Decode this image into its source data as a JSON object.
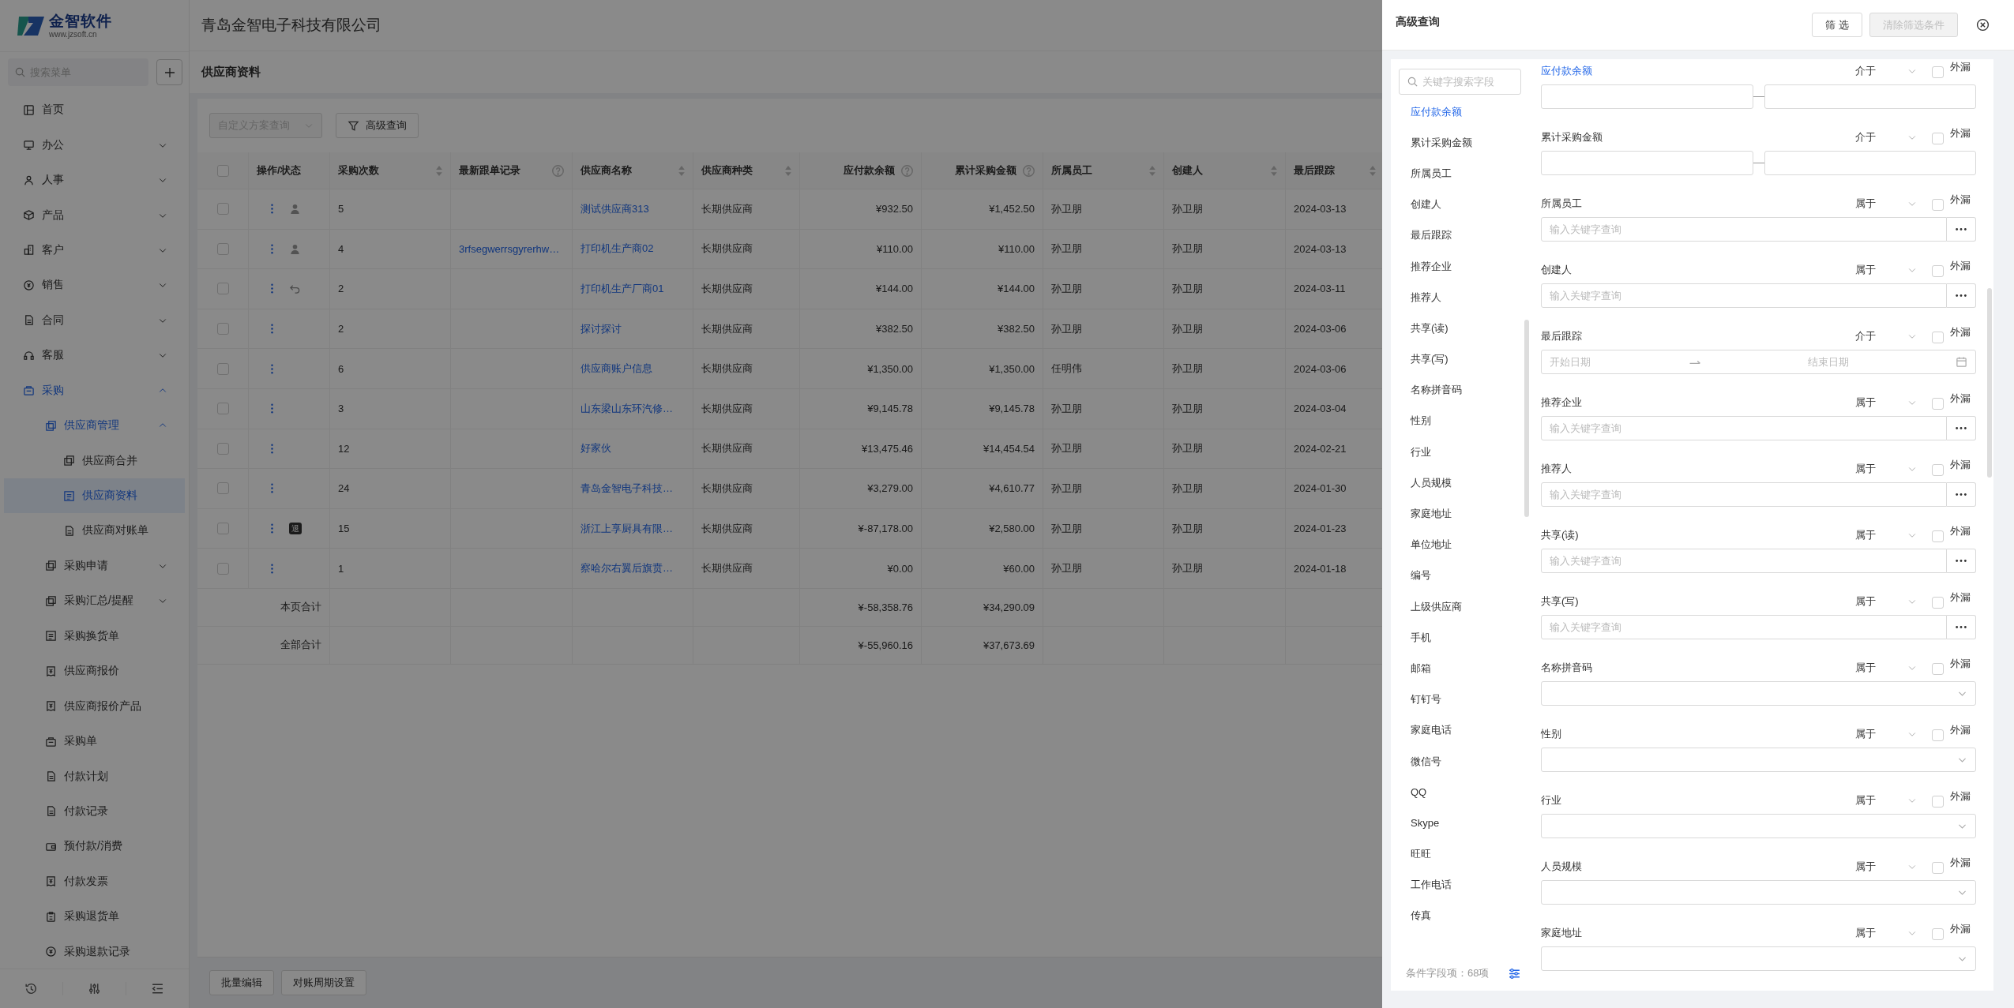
{
  "sidebar": {
    "brand": "金智软件",
    "url": "www.jzsoft.cn",
    "search": {
      "placeholder": "搜索菜单"
    },
    "items": [
      {
        "label": "首页",
        "selected": false
      },
      {
        "label": "办公",
        "selected": false,
        "expanded": false
      },
      {
        "label": "人事",
        "selected": false,
        "expanded": false
      },
      {
        "label": "产品",
        "selected": false,
        "expanded": false
      },
      {
        "label": "客户",
        "selected": false,
        "expanded": false
      },
      {
        "label": "销售",
        "selected": false,
        "expanded": false
      },
      {
        "label": "合同",
        "selected": false,
        "expanded": false
      },
      {
        "label": "客服",
        "selected": false,
        "expanded": false
      },
      {
        "label": "采购",
        "selected": false,
        "expanded": true,
        "children": [
          {
            "label": "供应商管理",
            "selected": false,
            "expanded": true,
            "children": [
              {
                "label": "供应商合并",
                "selected": false
              },
              {
                "label": "供应商资料",
                "selected": true
              },
              {
                "label": "供应商对账单",
                "selected": false
              }
            ]
          },
          {
            "label": "采购申请",
            "selected": false,
            "expanded": false
          },
          {
            "label": "采购汇总/提醒",
            "selected": false,
            "expanded": false
          },
          {
            "label": "采购换货单",
            "selected": false
          },
          {
            "label": "供应商报价",
            "selected": false
          },
          {
            "label": "供应商报价产品",
            "selected": false
          },
          {
            "label": "采购单",
            "selected": false
          },
          {
            "label": "付款计划",
            "selected": false
          },
          {
            "label": "付款记录",
            "selected": false
          },
          {
            "label": "预付款/消费",
            "selected": false
          },
          {
            "label": "付款发票",
            "selected": false
          },
          {
            "label": "采购退货单",
            "selected": false
          },
          {
            "label": "采购退款记录",
            "selected": false
          }
        ]
      }
    ]
  },
  "header": {
    "company": "青岛金智电子科技有限公司"
  },
  "page": {
    "title": "供应商资料",
    "scheme_select": {
      "placeholder": "自定义方案查询",
      "disabled": true
    },
    "advanced_button": "高级查询"
  },
  "table": {
    "select_all": {
      "checked": false
    },
    "columns": [
      {
        "label": "操作/状态",
        "kind": "actions"
      },
      {
        "label": "采购次数",
        "kind": "text",
        "sortable": true
      },
      {
        "label": "最新跟单记录",
        "kind": "link",
        "help": true
      },
      {
        "label": "供应商名称",
        "kind": "link",
        "sortable": true
      },
      {
        "label": "供应商种类",
        "kind": "text",
        "sortable": true
      },
      {
        "label": "应付款余额",
        "kind": "amount",
        "help": true
      },
      {
        "label": "累计采购金额",
        "kind": "amount",
        "help": true
      },
      {
        "label": "所属员工",
        "kind": "text",
        "sortable": true
      },
      {
        "label": "创建人",
        "kind": "text",
        "sortable": true
      },
      {
        "label": "最后跟踪",
        "kind": "text",
        "sortable": true
      }
    ],
    "rows": [
      {
        "checked": false,
        "status": {
          "kind": "person"
        },
        "count": "5",
        "name": "测试供应商313",
        "type": "长期供应商",
        "payable": "¥932.50",
        "total": "¥1,452.50",
        "employee": "孙卫朋",
        "creator": "孙卫朋",
        "last_follow": "2024-03-13"
      },
      {
        "checked": false,
        "status": {
          "kind": "person"
        },
        "count": "4",
        "latest_record": "3rfsegwerrsgyrerhw…",
        "name": "打印机生产商02",
        "type": "长期供应商",
        "payable": "¥110.00",
        "total": "¥110.00",
        "employee": "孙卫朋",
        "creator": "孙卫朋",
        "last_follow": "2024-03-13"
      },
      {
        "checked": false,
        "status": {
          "kind": "undo"
        },
        "count": "2",
        "name": "打印机生产厂商01",
        "type": "长期供应商",
        "payable": "¥144.00",
        "total": "¥144.00",
        "employee": "孙卫朋",
        "creator": "孙卫朋",
        "last_follow": "2024-03-11"
      },
      {
        "checked": false,
        "count": "2",
        "name": "探讨探讨",
        "type": "长期供应商",
        "payable": "¥382.50",
        "total": "¥382.50",
        "employee": "孙卫朋",
        "creator": "孙卫朋",
        "last_follow": "2024-03-06"
      },
      {
        "checked": false,
        "count": "6",
        "name": "供应商账户信息",
        "type": "长期供应商",
        "payable": "¥1,350.00",
        "total": "¥1,350.00",
        "employee": "任明伟",
        "creator": "孙卫朋",
        "last_follow": "2024-03-06"
      },
      {
        "checked": false,
        "count": "3",
        "name": "山东梁山东环汽修…",
        "type": "长期供应商",
        "payable": "¥9,145.78",
        "total": "¥9,145.78",
        "employee": "孙卫朋",
        "creator": "孙卫朋",
        "last_follow": "2024-03-04"
      },
      {
        "checked": false,
        "count": "12",
        "name": "好家伙",
        "type": "长期供应商",
        "payable": "¥13,475.46",
        "total": "¥14,454.54",
        "employee": "孙卫朋",
        "creator": "孙卫朋",
        "last_follow": "2024-02-21"
      },
      {
        "checked": false,
        "count": "24",
        "name": "青岛金智电子科技…",
        "type": "长期供应商",
        "payable": "¥3,279.00",
        "total": "¥4,610.77",
        "employee": "孙卫朋",
        "creator": "孙卫朋",
        "last_follow": "2024-01-30"
      },
      {
        "checked": false,
        "status": {
          "kind": "badge",
          "text": "退"
        },
        "count": "15",
        "name": "浙江上享厨具有限…",
        "type": "长期供应商",
        "payable": "¥-87,178.00",
        "total": "¥2,580.00",
        "employee": "孙卫朋",
        "creator": "孙卫朋",
        "last_follow": "2024-01-23"
      },
      {
        "checked": false,
        "count": "1",
        "name": "察哈尔右翼后旗贲…",
        "type": "长期供应商",
        "payable": "¥0.00",
        "total": "¥60.00",
        "employee": "孙卫朋",
        "creator": "孙卫朋",
        "last_follow": "2024-01-18"
      }
    ],
    "summaries": [
      {
        "label": "本页合计",
        "payable": "¥-58,358.76",
        "total": "¥34,290.09"
      },
      {
        "label": "全部合计",
        "payable": "¥-55,960.16",
        "total": "¥37,673.69"
      }
    ]
  },
  "footer_buttons": [
    "批量编辑",
    "对账周期设置"
  ],
  "drawer": {
    "title": "高级查询",
    "buttons": [
      {
        "label": "筛 选",
        "disabled": false
      },
      {
        "label": "清除筛选条件",
        "disabled": true
      }
    ],
    "field_search": {
      "placeholder": "关键字搜索字段"
    },
    "fields": [
      {
        "label": "应付款余额",
        "selected": true
      },
      {
        "label": "累计采购金额",
        "selected": false
      },
      {
        "label": "所属员工",
        "selected": false
      },
      {
        "label": "创建人",
        "selected": false
      },
      {
        "label": "最后跟踪",
        "selected": false
      },
      {
        "label": "推荐企业",
        "selected": false
      },
      {
        "label": "推荐人",
        "selected": false
      },
      {
        "label": "共享(读)",
        "selected": false
      },
      {
        "label": "共享(写)",
        "selected": false
      },
      {
        "label": "名称拼音码",
        "selected": false
      },
      {
        "label": "性别",
        "selected": false
      },
      {
        "label": "行业",
        "selected": false
      },
      {
        "label": "人员规模",
        "selected": false
      },
      {
        "label": "家庭地址",
        "selected": false
      },
      {
        "label": "单位地址",
        "selected": false
      },
      {
        "label": "编号",
        "selected": false
      },
      {
        "label": "上级供应商",
        "selected": false
      },
      {
        "label": "手机",
        "selected": false
      },
      {
        "label": "邮箱",
        "selected": false
      },
      {
        "label": "钉钉号",
        "selected": false
      },
      {
        "label": "家庭电话",
        "selected": false
      },
      {
        "label": "微信号",
        "selected": false
      },
      {
        "label": "QQ",
        "selected": false
      },
      {
        "label": "Skype",
        "selected": false
      },
      {
        "label": "旺旺",
        "selected": false
      },
      {
        "label": "工作电话",
        "selected": false
      },
      {
        "label": "传真",
        "selected": false
      }
    ],
    "field_count": "条件字段项：68项",
    "conditions": [
      {
        "label": "应付款余额",
        "highlighted": true,
        "operator": "介于",
        "kind": "range",
        "checked": false,
        "checkbox_label": "外漏"
      },
      {
        "label": "累计采购金额",
        "highlighted": false,
        "operator": "介于",
        "kind": "range",
        "checked": false,
        "checkbox_label": "外漏"
      },
      {
        "label": "所属员工",
        "highlighted": false,
        "operator": "属于",
        "kind": "picker",
        "placeholder": "输入关键字查询",
        "checked": false,
        "checkbox_label": "外漏"
      },
      {
        "label": "创建人",
        "highlighted": false,
        "operator": "属于",
        "kind": "picker",
        "placeholder": "输入关键字查询",
        "checked": false,
        "checkbox_label": "外漏"
      },
      {
        "label": "最后跟踪",
        "highlighted": false,
        "operator": "介于",
        "kind": "daterange",
        "start_placeholder": "开始日期",
        "end_placeholder": "结束日期",
        "checked": false,
        "checkbox_label": "外漏"
      },
      {
        "label": "推荐企业",
        "highlighted": false,
        "operator": "属于",
        "kind": "picker",
        "placeholder": "输入关键字查询",
        "checked": false,
        "checkbox_label": "外漏"
      },
      {
        "label": "推荐人",
        "highlighted": false,
        "operator": "属于",
        "kind": "picker",
        "placeholder": "输入关键字查询",
        "checked": false,
        "checkbox_label": "外漏"
      },
      {
        "label": "共享(读)",
        "highlighted": false,
        "operator": "属于",
        "kind": "picker",
        "placeholder": "输入关键字查询",
        "checked": false,
        "checkbox_label": "外漏"
      },
      {
        "label": "共享(写)",
        "highlighted": false,
        "operator": "属于",
        "kind": "picker",
        "placeholder": "输入关键字查询",
        "checked": false,
        "checkbox_label": "外漏"
      },
      {
        "label": "名称拼音码",
        "highlighted": false,
        "operator": "属于",
        "kind": "select",
        "checked": false,
        "checkbox_label": "外漏"
      },
      {
        "label": "性别",
        "highlighted": false,
        "operator": "属于",
        "kind": "select",
        "checked": false,
        "checkbox_label": "外漏"
      },
      {
        "label": "行业",
        "highlighted": false,
        "operator": "属于",
        "kind": "select",
        "checked": false,
        "checkbox_label": "外漏"
      },
      {
        "label": "人员规模",
        "highlighted": false,
        "operator": "属于",
        "kind": "select",
        "checked": false,
        "checkbox_label": "外漏"
      },
      {
        "label": "家庭地址",
        "highlighted": false,
        "operator": "属于",
        "kind": "select",
        "checked": false,
        "checkbox_label": "外漏"
      }
    ]
  }
}
